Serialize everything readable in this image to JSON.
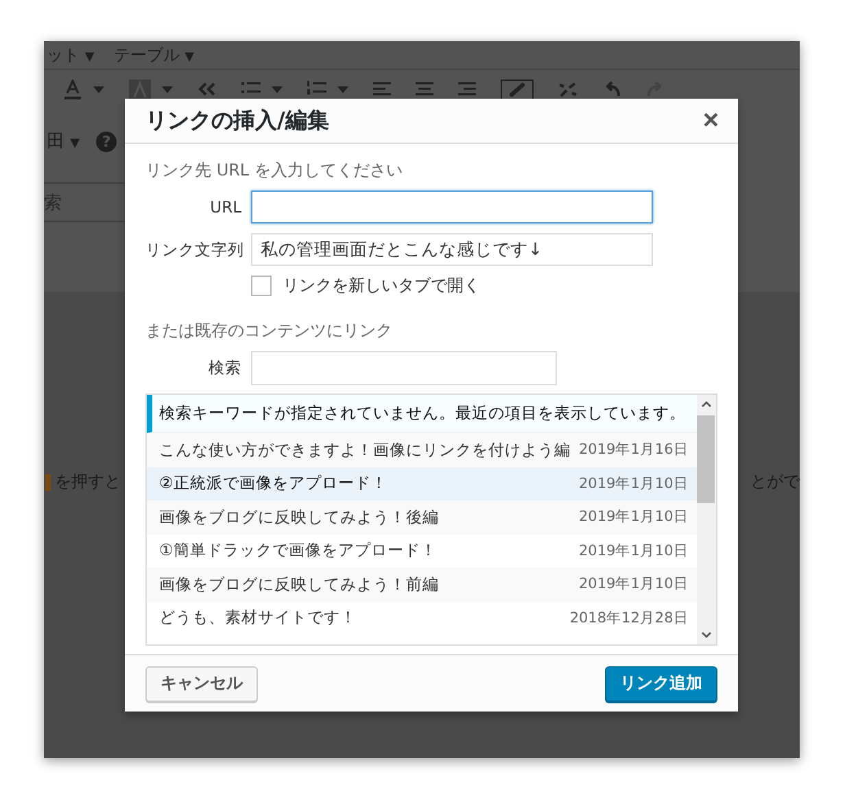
{
  "editor": {
    "menus": [
      {
        "label": "ット",
        "caret": "▼"
      },
      {
        "label": "テーブル",
        "caret": "▼"
      }
    ],
    "table_button": {
      "glyph": "田",
      "caret": "▼"
    },
    "help_glyph": "?",
    "search_fragment": "索",
    "line_fragments": [
      "を押すと",
      "とがで"
    ]
  },
  "dialog": {
    "title": "リンクの挿入/編集",
    "close": "×",
    "intro": "リンク先 URL を入力してください",
    "url": {
      "label": "URL",
      "focused": true
    },
    "link_text": {
      "label": "リンク文字列",
      "value": "私の管理画面だとこんな感じです↓"
    },
    "new_tab": {
      "label": "リンクを新しいタブで開く",
      "checked": false
    },
    "existing_heading": "または既存のコンテンツにリンク",
    "search": {
      "label": "検索"
    },
    "results": {
      "notice": "検索キーワードが指定されていません。最近の項目を表示しています。",
      "items": [
        {
          "title": "こんな使い方ができますよ！画像にリンクを付けよう編",
          "date": "2019年1月16日",
          "selected": false
        },
        {
          "title": "②正統派で画像をアプロード！",
          "date": "2019年1月10日",
          "selected": true
        },
        {
          "title": "画像をブログに反映してみよう！後編",
          "date": "2019年1月10日",
          "selected": false
        },
        {
          "title": "①簡単ドラックで画像をアプロード！",
          "date": "2019年1月10日",
          "selected": false
        },
        {
          "title": "画像をブログに反映してみよう！前編",
          "date": "2019年1月10日",
          "selected": false
        },
        {
          "title": "どうも、素材サイトです！",
          "date": "2018年12月28日",
          "selected": false
        }
      ]
    },
    "buttons": {
      "cancel": "キャンセル",
      "submit": "リンク追加"
    }
  }
}
